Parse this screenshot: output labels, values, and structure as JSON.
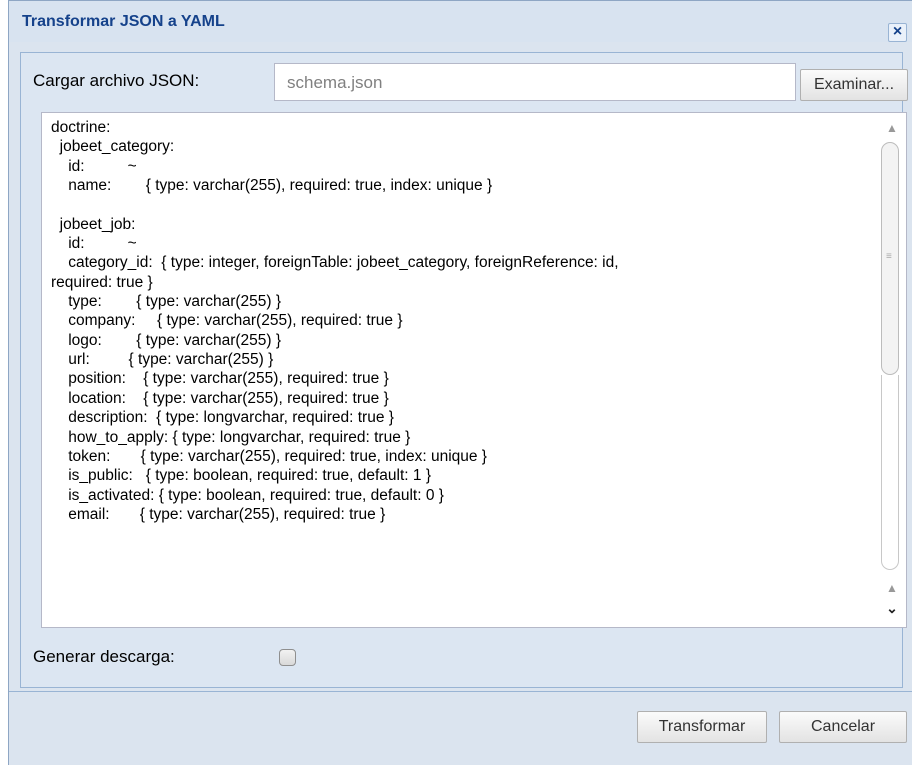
{
  "dialog": {
    "title": "Transformar JSON a YAML",
    "close_icon": "close-icon"
  },
  "load": {
    "label": "Cargar archivo JSON:",
    "file_value": "schema.json",
    "browse_label": "Examinar..."
  },
  "editor": {
    "text": "doctrine:\n  jobeet_category:\n    id:          ~\n    name:        { type: varchar(255), required: true, index: unique }\n\n  jobeet_job:\n    id:          ~\n    category_id:  { type: integer, foreignTable: jobeet_category, foreignReference: id,\nrequired: true }\n    type:        { type: varchar(255) }\n    company:     { type: varchar(255), required: true }\n    logo:        { type: varchar(255) }\n    url:         { type: varchar(255) }\n    position:    { type: varchar(255), required: true }\n    location:    { type: varchar(255), required: true }\n    description:  { type: longvarchar, required: true }\n    how_to_apply: { type: longvarchar, required: true }\n    token:       { type: varchar(255), required: true, index: unique }\n    is_public:   { type: boolean, required: true, default: 1 }\n    is_activated: { type: boolean, required: true, default: 0 }\n    email:       { type: varchar(255), required: true }"
  },
  "download": {
    "label": "Generar descarga:",
    "checked": false
  },
  "buttons": {
    "transform": "Transformar",
    "cancel": "Cancelar"
  },
  "colors": {
    "title": "#15428b",
    "panel_bg": "#dce6f2",
    "border": "#99b4d4"
  }
}
